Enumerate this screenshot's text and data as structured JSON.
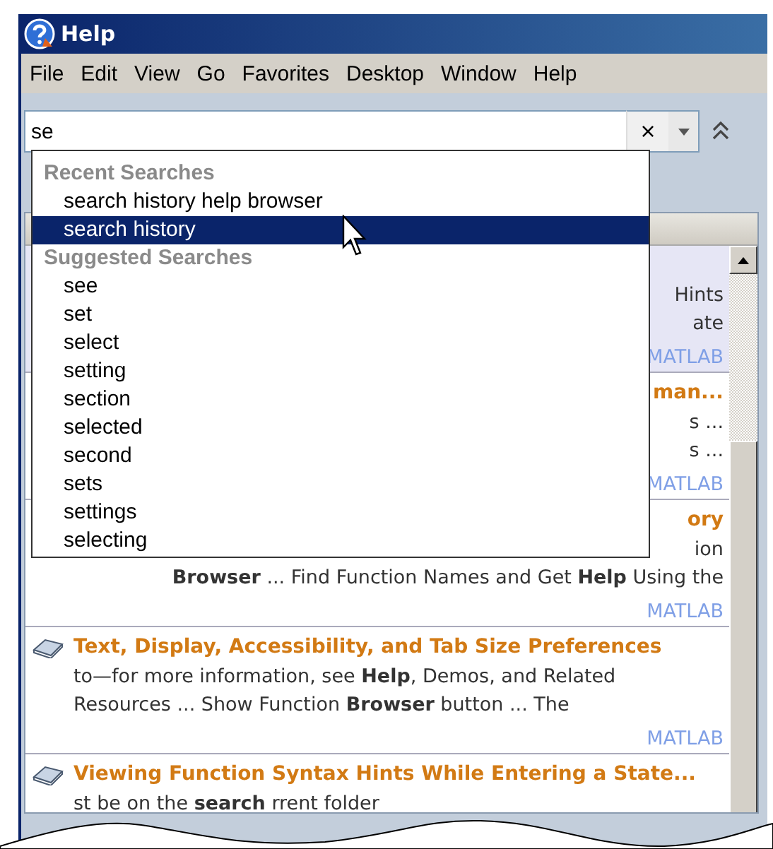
{
  "window": {
    "title": "Help"
  },
  "menu": [
    "File",
    "Edit",
    "View",
    "Go",
    "Favorites",
    "Desktop",
    "Window",
    "Help"
  ],
  "search": {
    "value": "se",
    "clear": "×"
  },
  "popup": [
    {
      "heading": "Recent Searches",
      "items": [
        {
          "label": "search history help browser",
          "selected": false
        },
        {
          "label": "search history",
          "selected": true
        }
      ]
    },
    {
      "heading": "Suggested Searches",
      "items": [
        {
          "label": "see",
          "selected": false
        },
        {
          "label": "set",
          "selected": false
        },
        {
          "label": "select",
          "selected": false
        },
        {
          "label": "setting",
          "selected": false
        },
        {
          "label": "section",
          "selected": false
        },
        {
          "label": "selected",
          "selected": false
        },
        {
          "label": "second",
          "selected": false
        },
        {
          "label": "sets",
          "selected": false
        },
        {
          "label": "settings",
          "selected": false
        },
        {
          "label": "selecting",
          "selected": false
        }
      ]
    }
  ],
  "results": [
    {
      "kind": "partial",
      "selected": true,
      "lines": [
        "Hints",
        "ate"
      ],
      "source": "MATLAB"
    },
    {
      "kind": "partial",
      "selected": false,
      "title": "man...",
      "lines": [
        "s ...",
        "s ..."
      ],
      "source": "MATLAB"
    },
    {
      "kind": "partial",
      "selected": false,
      "title": "ory",
      "lines": [
        "ion",
        "**Browser** ... Find Function Names and Get **Help** Using the"
      ],
      "source": "MATLAB"
    },
    {
      "kind": "full",
      "selected": false,
      "title": "Text, Display, Accessibility, and Tab Size Preferences",
      "lines": [
        "to—for more information, see **Help**, Demos, and Related",
        "Resources ... Show Function **Browser** button ... The"
      ],
      "source": "MATLAB"
    },
    {
      "kind": "full",
      "selected": false,
      "title": "Viewing Function Syntax Hints While Entering a State...",
      "lines": [
        "st be on the **search**          rrent folder"
      ]
    }
  ]
}
